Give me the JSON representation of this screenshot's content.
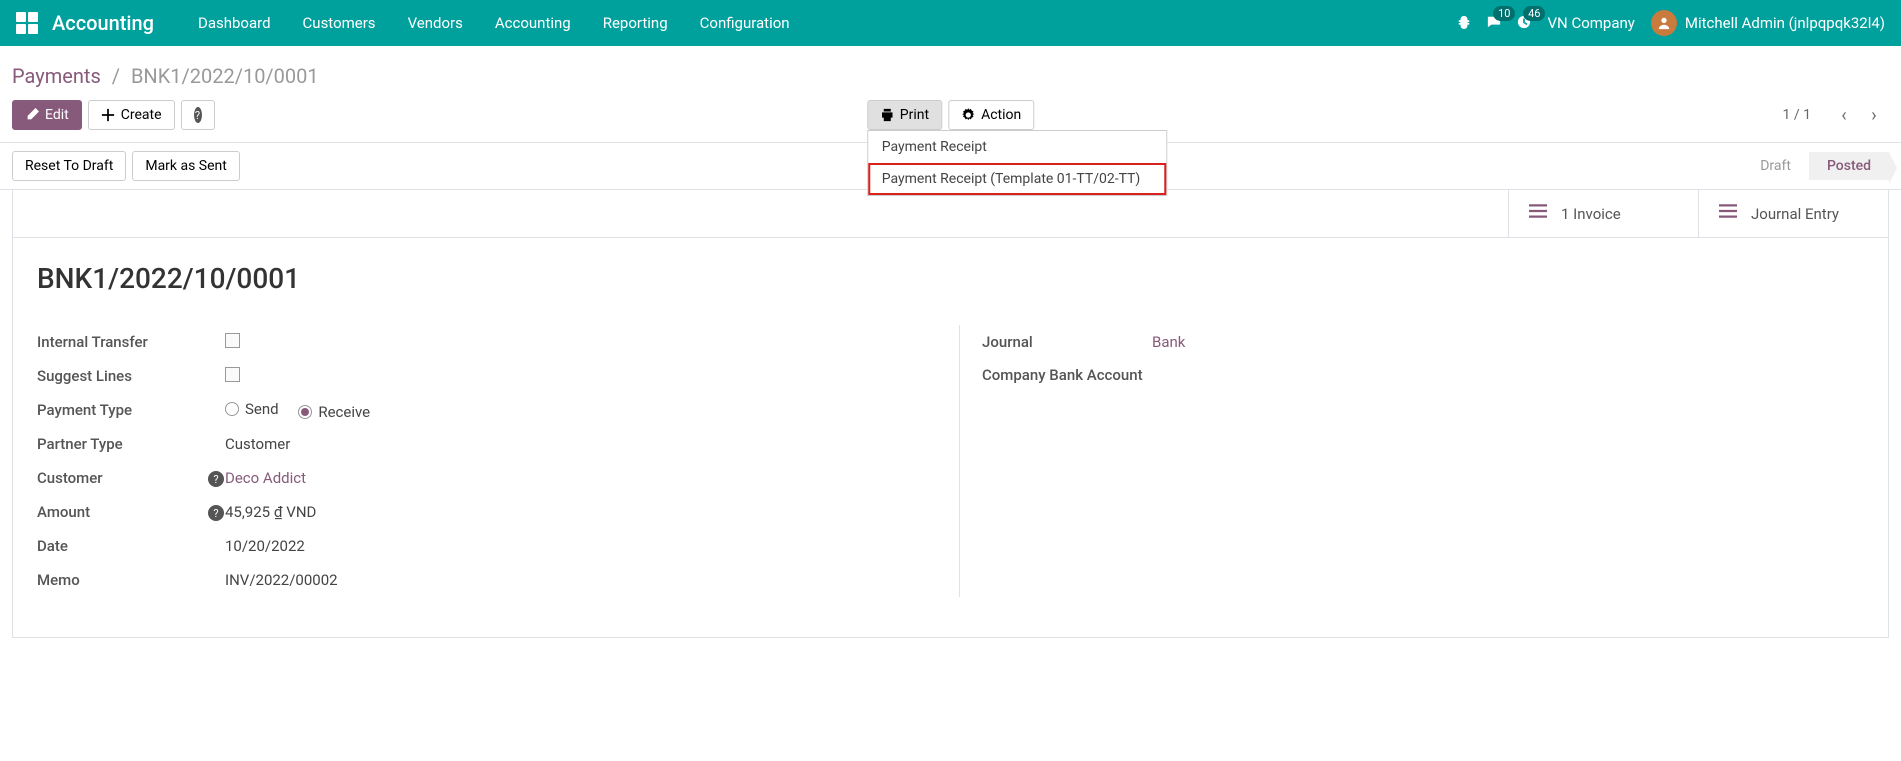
{
  "nav": {
    "app": "Accounting",
    "items": [
      "Dashboard",
      "Customers",
      "Vendors",
      "Accounting",
      "Reporting",
      "Configuration"
    ],
    "messages_badge": "10",
    "activities_badge": "46",
    "company": "VN Company",
    "user": "Mitchell Admin (jnlpqpqk32l4)"
  },
  "breadcrumb": {
    "parent": "Payments",
    "current": "BNK1/2022/10/0001"
  },
  "buttons": {
    "edit": "Edit",
    "create": "Create",
    "print": "Print",
    "action": "Action",
    "reset": "Reset To Draft",
    "mark_sent": "Mark as Sent"
  },
  "print_menu": {
    "item1": "Payment Receipt",
    "item2": "Payment Receipt (Template 01-TT/02-TT)"
  },
  "pager": {
    "count": "1 / 1"
  },
  "stages": {
    "draft": "Draft",
    "posted": "Posted"
  },
  "stats": {
    "invoice_count": "1",
    "invoice_label": "Invoice",
    "journal_label": "Journal Entry"
  },
  "record": {
    "title": "BNK1/2022/10/0001",
    "labels": {
      "internal_transfer": "Internal Transfer",
      "suggest_lines": "Suggest Lines",
      "payment_type": "Payment Type",
      "partner_type": "Partner Type",
      "customer": "Customer",
      "amount": "Amount",
      "date": "Date",
      "memo": "Memo",
      "journal": "Journal",
      "company_bank_account": "Company Bank Account"
    },
    "payment_type": {
      "send": "Send",
      "receive": "Receive"
    },
    "partner_type": "Customer",
    "customer": "Deco Addict",
    "amount_num": "45,925",
    "amount_sym": "₫",
    "amount_cur": "VND",
    "date": "10/20/2022",
    "memo": "INV/2022/00002",
    "journal": "Bank"
  }
}
